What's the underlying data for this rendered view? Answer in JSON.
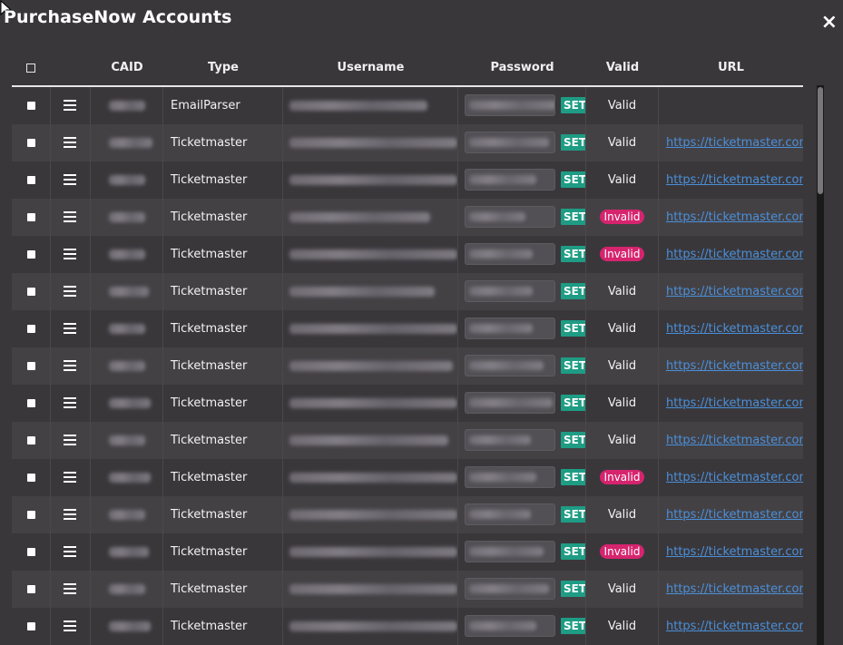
{
  "modal": {
    "title": "PurchaseNow Accounts",
    "close_label": "×"
  },
  "table": {
    "columns": [
      "",
      "CAID",
      "Type",
      "Username",
      "Password",
      "Valid",
      "URL"
    ],
    "set_label": "SET",
    "rows": [
      {
        "type": "EmailParser",
        "valid": "Valid",
        "url": ""
      },
      {
        "type": "Ticketmaster",
        "valid": "Valid",
        "url": "https://ticketmaster.com"
      },
      {
        "type": "Ticketmaster",
        "valid": "Valid",
        "url": "https://ticketmaster.com"
      },
      {
        "type": "Ticketmaster",
        "valid": "Invalid",
        "url": "https://ticketmaster.com"
      },
      {
        "type": "Ticketmaster",
        "valid": "Invalid",
        "url": "https://ticketmaster.com"
      },
      {
        "type": "Ticketmaster",
        "valid": "Valid",
        "url": "https://ticketmaster.com"
      },
      {
        "type": "Ticketmaster",
        "valid": "Valid",
        "url": "https://ticketmaster.com"
      },
      {
        "type": "Ticketmaster",
        "valid": "Valid",
        "url": "https://ticketmaster.com"
      },
      {
        "type": "Ticketmaster",
        "valid": "Valid",
        "url": "https://ticketmaster.com"
      },
      {
        "type": "Ticketmaster",
        "valid": "Valid",
        "url": "https://ticketmaster.com"
      },
      {
        "type": "Ticketmaster",
        "valid": "Invalid",
        "url": "https://ticketmaster.com"
      },
      {
        "type": "Ticketmaster",
        "valid": "Valid",
        "url": "https://ticketmaster.com"
      },
      {
        "type": "Ticketmaster",
        "valid": "Invalid",
        "url": "https://ticketmaster.com"
      },
      {
        "type": "Ticketmaster",
        "valid": "Valid",
        "url": "https://ticketmaster.com"
      },
      {
        "type": "Ticketmaster",
        "valid": "Valid",
        "url": "https://ticketmaster.com"
      }
    ]
  },
  "colors": {
    "background": "#3a373b",
    "row_alt": "#444145",
    "set_button": "#1e9c84",
    "invalid_badge": "#d6246e",
    "link": "#4a90d9"
  },
  "icons": {
    "row_menu": "hamburger-icon",
    "close": "close-icon",
    "cursor": "mouse-pointer-icon"
  }
}
